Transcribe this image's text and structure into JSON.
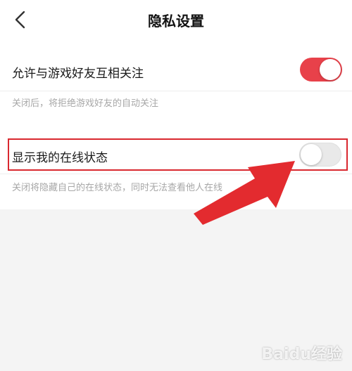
{
  "header": {
    "title": "隐私设置",
    "back_icon": "chevron-left-icon"
  },
  "settings": [
    {
      "label": "允许与游戏好友互相关注",
      "description": "关闭后，将拒绝游戏好友的自动关注",
      "enabled": true
    },
    {
      "label": "显示我的在线状态",
      "description": "关闭将隐藏自己的在线状态，同时无法查看他人在线",
      "enabled": false
    }
  ],
  "colors": {
    "toggle_on": "#e8414a",
    "toggle_off": "#e9e9e9",
    "annotation": "#d9282f"
  },
  "watermark": "Baidu经验"
}
